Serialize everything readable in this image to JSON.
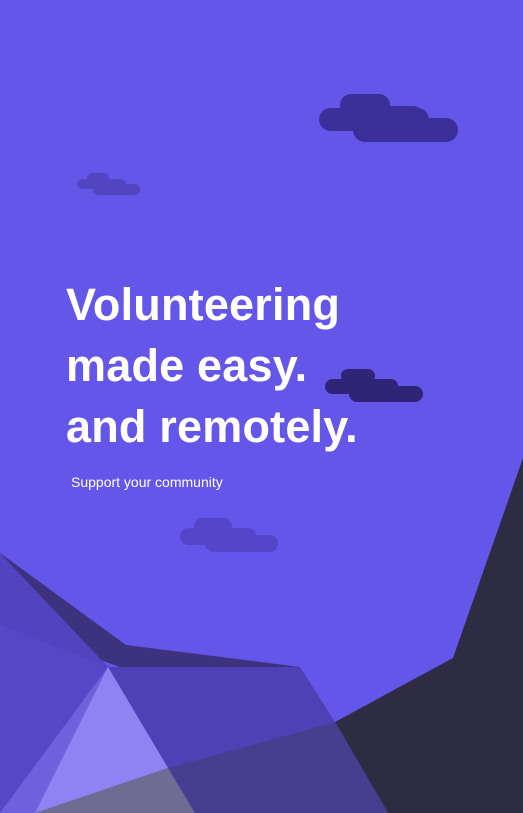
{
  "hero": {
    "headline_lines": [
      "Volunteering",
      "made easy.",
      "and remotely."
    ],
    "tagline": "Support your community"
  },
  "colors": {
    "background": "#6556EA",
    "text": "#FFFFFF",
    "cloud_dark": "#3B2F9A",
    "cloud_darker": "#2E2577",
    "cloud_light": "#5346C8",
    "mountain_dark": "#2D2C43"
  }
}
